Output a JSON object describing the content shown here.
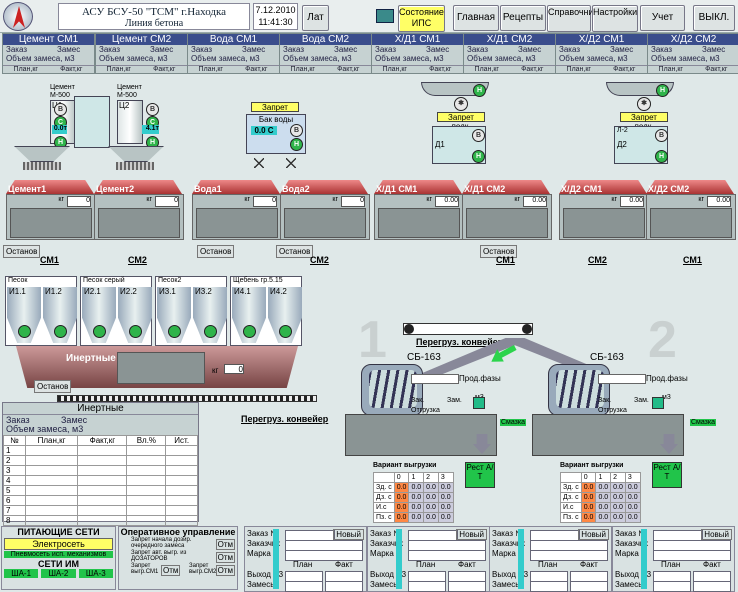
{
  "header": {
    "title": "АСУ БСУ-50 \"ТСМ\" г.Находка",
    "subtitle": "Линия бетона",
    "date": "7.12.2010",
    "time": "11:41:30",
    "lang_button": "Лат",
    "state_button": "Состояние ИПС",
    "nav": [
      "Главная",
      "Рецепты",
      "Справочники",
      "Настройки",
      "Учет",
      "ВЫКЛ."
    ]
  },
  "line_headers": [
    {
      "title": "Цемент СМ1",
      "order": "Заказ",
      "batch": "Замес",
      "volume": "Объем замеса, м3",
      "plan": "План,кг",
      "fact": "Факт,кг"
    },
    {
      "title": "Цемент СМ2",
      "order": "Заказ",
      "batch": "Замес",
      "volume": "Объем замеса, м3",
      "plan": "План,кг",
      "fact": "Факт,кг"
    },
    {
      "title": "Вода СМ1",
      "order": "Заказ",
      "batch": "Замес",
      "volume": "Объем замеса, м3",
      "plan": "План,кг",
      "fact": "Факт,кг"
    },
    {
      "title": "Вода СМ2",
      "order": "Заказ",
      "batch": "Замес",
      "volume": "Объем замеса, м3",
      "plan": "План,кг",
      "fact": "Факт,кг"
    },
    {
      "title": "Х/Д1 СМ1",
      "order": "Заказ",
      "batch": "Замес",
      "volume": "Объем замеса, м3",
      "plan": "План,кг",
      "fact": "Факт,кг"
    },
    {
      "title": "Х/Д1 СМ2",
      "order": "Заказ",
      "batch": "Замес",
      "volume": "Объем замеса, м3",
      "plan": "План,кг",
      "fact": "Факт,кг"
    },
    {
      "title": "Х/Д2 СМ1",
      "order": "Заказ",
      "batch": "Замес",
      "volume": "Объем замеса, м3",
      "plan": "План,кг",
      "fact": "Факт,кг"
    },
    {
      "title": "Х/Д2 СМ2",
      "order": "Заказ",
      "batch": "Замес",
      "volume": "Объем замеса, м3",
      "plan": "План,кг",
      "fact": "Факт,кг"
    }
  ],
  "silos": {
    "c1": {
      "name": "Цемент М-500",
      "id": "Ц1",
      "value": "0.0т"
    },
    "c2": {
      "name": "Цемент М-500",
      "id": "Ц2",
      "value": "4.1т"
    },
    "water": {
      "name": "Бак воды",
      "value": "0.0 С",
      "block": "Запрет подк."
    },
    "d1": {
      "id": "Д1",
      "block": "Запрет подк."
    },
    "d2": {
      "id": "Д2",
      "block": "Запрет подк.",
      "tag": "Л-2"
    }
  },
  "scales": [
    {
      "label": "Цемент1",
      "kg": "кг",
      "value": "0"
    },
    {
      "label": "Цемент2",
      "kg": "кг",
      "value": "0"
    },
    {
      "label": "Вода1",
      "kg": "кг",
      "value": "0"
    },
    {
      "label": "Вода2",
      "kg": "кг",
      "value": "0"
    },
    {
      "label": "Х/Д1 СМ1",
      "kg": "кг",
      "value": "0.00"
    },
    {
      "label": "Х/Д1 СМ2",
      "kg": "кг",
      "value": "0.00"
    },
    {
      "label": "Х/Д2 СМ1",
      "kg": "кг",
      "value": "0.00"
    },
    {
      "label": "Х/Д2 СМ2",
      "kg": "кг",
      "value": "0.00"
    }
  ],
  "stop_label": "Останов",
  "mixer_links": [
    "СМ1",
    "СМ2",
    "СМ2",
    "СМ1",
    "СМ2",
    "СМ1",
    "СМ2"
  ],
  "aggregates": {
    "groups": [
      "Песок",
      "Песок серый",
      "Песок2",
      "Щебень гр.5.15"
    ],
    "bins": [
      "И1.1",
      "И1.2",
      "И2.1",
      "И2.2",
      "И3.1",
      "И3.2",
      "И4.1",
      "И4.2"
    ],
    "conveyor_label": "Инертные",
    "kg": "кг",
    "kg_value": "0",
    "stop": "Останов",
    "reload": "Перегруз. конвейер"
  },
  "inert_table": {
    "title": "Инертные",
    "order": "Заказ",
    "batch": "Замес",
    "volume": "Объем замеса, м3",
    "cols": [
      "№",
      "План,кг",
      "Факт,кг",
      "Вл.%",
      "Ист."
    ],
    "rows": [
      "1",
      "2",
      "3",
      "4",
      "5",
      "6",
      "7",
      "8"
    ]
  },
  "mixers": [
    {
      "name": "СБ-163",
      "big_num": "1",
      "prod": "Прод.фазы",
      "zak": "Зак.",
      "zam": "Зам.",
      "m3": "м3",
      "out": "Отгрузка",
      "lube": "Смазка",
      "rest": "Рест А/Т"
    },
    {
      "name": "СБ-163",
      "big_num": "2",
      "prod": "Прод.фазы",
      "zak": "Зак.",
      "zam": "Зам.",
      "m3": "м3",
      "out": "Отгрузка",
      "lube": "Смазка",
      "rest": "Рест А/Т"
    }
  ],
  "center_reload": "Перегруз. конвейер",
  "unload": {
    "title": "Вариант выгрузки",
    "rows": [
      "Зд. с",
      "Дз. с",
      "И.с",
      "Пз. с"
    ],
    "cols": [
      "0",
      "1",
      "2",
      "3"
    ],
    "value": "0.0"
  },
  "feed_nets": {
    "title": "ПИТАЮЩИЕ СЕТИ",
    "power": "Электросеть",
    "pneumo": "Пневмосеть исп. механизмов",
    "im_title": "СЕТИ ИМ",
    "im": [
      "ША-1",
      "ША-2",
      "ША-3"
    ]
  },
  "op_control": {
    "title": "Оперативное управление",
    "items": [
      {
        "text": "Запрет начала дозир. очередного замеса",
        "btn": "Отм"
      },
      {
        "text": "Запрет авт. выгр. из ДОЗАТОРОВ",
        "btn": "Отм"
      },
      {
        "text": "Запрет выгр.СМ1",
        "btn": "Отм"
      },
      {
        "text": "Запрет выгр.СМ2",
        "btn": "Отм"
      }
    ]
  },
  "orders": [
    {
      "order": "Заказ №",
      "new": "Новый",
      "customer": "Заказчик",
      "mark": "Марка",
      "plan": "План",
      "fact": "Факт",
      "out": "Выход м3",
      "batches": "Замесы"
    },
    {
      "order": "Заказ №",
      "new": "Новый",
      "customer": "Заказчик",
      "mark": "Марка",
      "plan": "План",
      "fact": "Факт",
      "out": "Выход м3",
      "batches": "Замесы"
    },
    {
      "order": "Заказ №",
      "new": "Новый",
      "customer": "Заказчик",
      "mark": "Марка",
      "plan": "План",
      "fact": "Факт",
      "out": "Выход м3",
      "batches": "Замесы"
    },
    {
      "order": "Заказ №",
      "new": "Новый",
      "customer": "Заказчик",
      "mark": "Марка",
      "plan": "План",
      "fact": "Факт",
      "out": "Выход м3",
      "batches": "Замесы"
    }
  ],
  "colors": {
    "accent": "#3a4d8c",
    "green": "#21c44a",
    "yellow": "#ffff66"
  }
}
